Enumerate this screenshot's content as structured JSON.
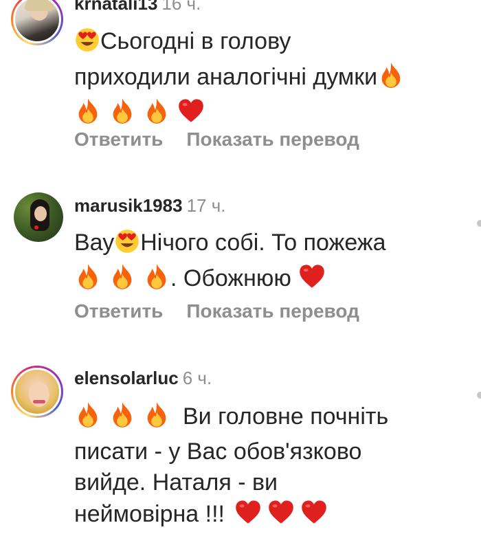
{
  "comments": [
    {
      "username": "krnatali13",
      "time": "16 ч.",
      "line1": "Сьогодні в голову",
      "line2": "приходили аналогічні думки",
      "reply_label": "Ответить",
      "translate_label": "Показать перевод",
      "avatar_icon": "user-photo-blonde",
      "has_story_ring": true
    },
    {
      "username": "marusik1983",
      "time": "17 ч.",
      "line1_a": "Вау",
      "line1_b": "Нічого собі. То пожежа",
      "line2": ". Обожнюю",
      "reply_label": "Ответить",
      "translate_label": "Показать перевод",
      "avatar_icon": "user-photo-dark-hair",
      "has_story_ring": false
    },
    {
      "username": "elensolarluc",
      "time": "6 ч.",
      "line1": "Ви головне почніть",
      "line2": "писати - у Вас обов'язково",
      "line3": "вийде. Наталя - ви",
      "line4": "неймовірна !!!",
      "avatar_icon": "user-photo-blonde-smiling",
      "has_story_ring": true
    }
  ],
  "colors": {
    "text": "#262626",
    "secondary": "#8e8e8e",
    "fire": "#f7630c",
    "heart": "#e0201f"
  },
  "icons": {
    "fire": "fire-emoji-icon",
    "heart": "red-heart-emoji-icon",
    "heart_eyes": "heart-eyes-emoji-icon"
  }
}
